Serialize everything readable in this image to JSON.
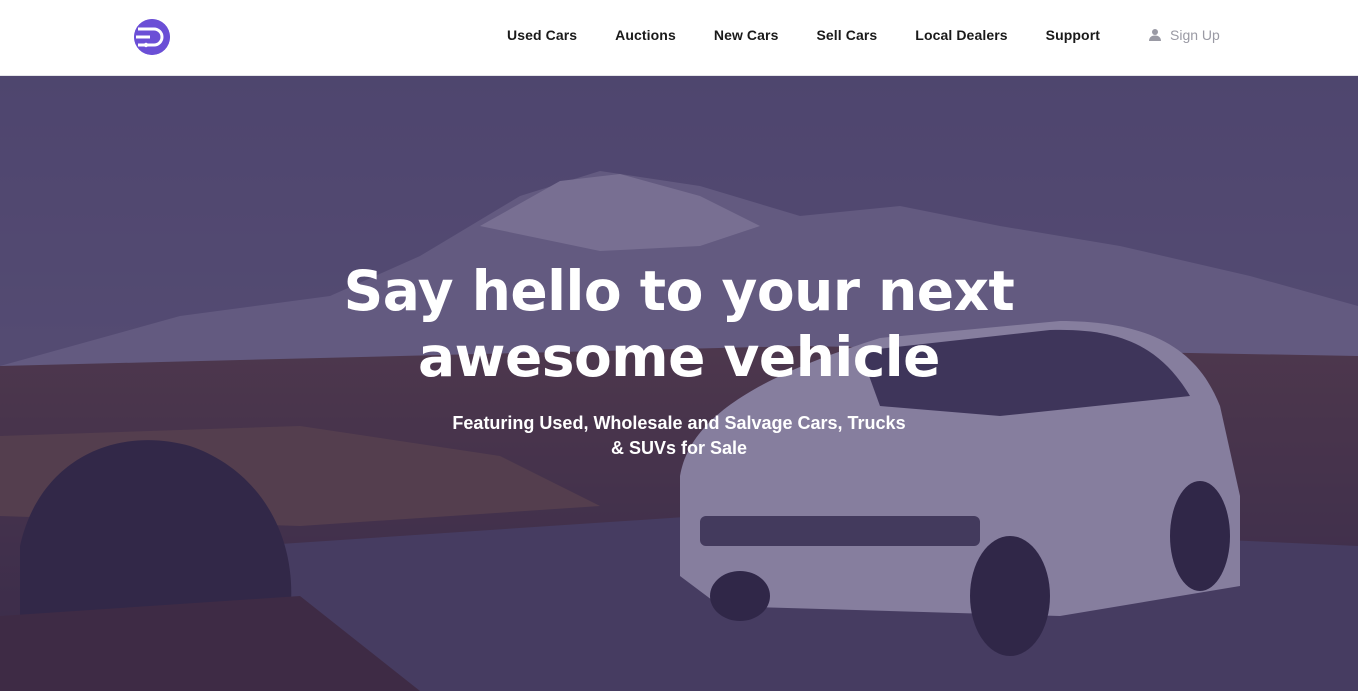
{
  "app": {
    "logo_icon": "car-logo-icon",
    "brand_color": "#6b4fd6"
  },
  "nav": {
    "items": [
      {
        "label": "Used Cars"
      },
      {
        "label": "Auctions"
      },
      {
        "label": "New Cars"
      },
      {
        "label": "Sell Cars"
      },
      {
        "label": "Local Dealers"
      },
      {
        "label": "Support"
      }
    ],
    "signup_label": "Sign Up",
    "signup_icon": "user-icon"
  },
  "hero": {
    "title_line1": "Say hello to your next",
    "title_line2": "awesome vehicle",
    "subtitle_line1": "Featuring Used, Wholesale and Salvage Cars, Trucks",
    "subtitle_line2": "& SUVs for Sale",
    "overlay_color": "#34285c"
  }
}
